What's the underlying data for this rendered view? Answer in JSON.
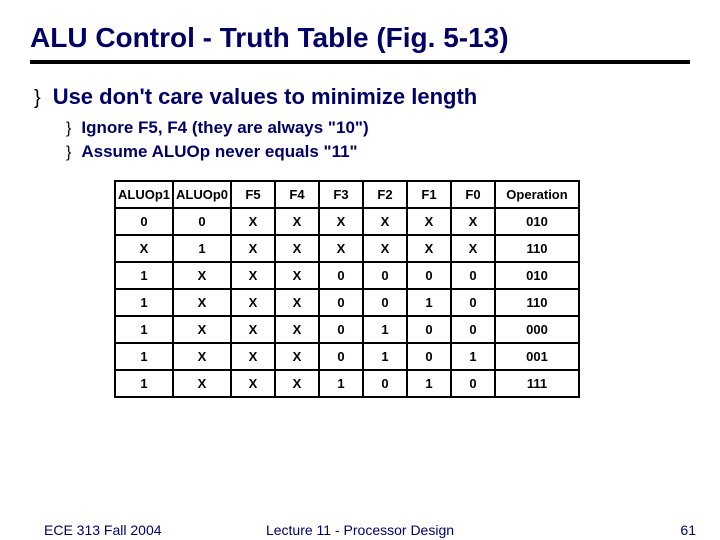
{
  "title": "ALU Control - Truth Table (Fig. 5-13)",
  "bullets": {
    "main": "Use don't care values to minimize length",
    "sub1": "Ignore F5, F4 (they are always \"10\")",
    "sub2": "Assume ALUOp never equals \"11\""
  },
  "table": {
    "headers": [
      "ALUOp1",
      "ALUOp0",
      "F5",
      "F4",
      "F3",
      "F2",
      "F1",
      "F0",
      "Operation"
    ],
    "rows": [
      [
        "0",
        "0",
        "X",
        "X",
        "X",
        "X",
        "X",
        "X",
        "010"
      ],
      [
        "X",
        "1",
        "X",
        "X",
        "X",
        "X",
        "X",
        "X",
        "110"
      ],
      [
        "1",
        "X",
        "X",
        "X",
        "0",
        "0",
        "0",
        "0",
        "010"
      ],
      [
        "1",
        "X",
        "X",
        "X",
        "0",
        "0",
        "1",
        "0",
        "110"
      ],
      [
        "1",
        "X",
        "X",
        "X",
        "0",
        "1",
        "0",
        "0",
        "000"
      ],
      [
        "1",
        "X",
        "X",
        "X",
        "0",
        "1",
        "0",
        "1",
        "001"
      ],
      [
        "1",
        "X",
        "X",
        "X",
        "1",
        "0",
        "1",
        "0",
        "111"
      ]
    ]
  },
  "footer": {
    "left": "ECE 313 Fall 2004",
    "center": "Lecture 11 - Processor Design",
    "right": "61"
  },
  "chart_data": {
    "type": "table",
    "title": "ALU Control - Truth Table (Fig. 5-13)",
    "columns": [
      "ALUOp1",
      "ALUOp0",
      "F5",
      "F4",
      "F3",
      "F2",
      "F1",
      "F0",
      "Operation"
    ],
    "rows": [
      [
        "0",
        "0",
        "X",
        "X",
        "X",
        "X",
        "X",
        "X",
        "010"
      ],
      [
        "X",
        "1",
        "X",
        "X",
        "X",
        "X",
        "X",
        "X",
        "110"
      ],
      [
        "1",
        "X",
        "X",
        "X",
        "0",
        "0",
        "0",
        "0",
        "010"
      ],
      [
        "1",
        "X",
        "X",
        "X",
        "0",
        "0",
        "1",
        "0",
        "110"
      ],
      [
        "1",
        "X",
        "X",
        "X",
        "0",
        "1",
        "0",
        "0",
        "000"
      ],
      [
        "1",
        "X",
        "X",
        "X",
        "0",
        "1",
        "0",
        "1",
        "001"
      ],
      [
        "1",
        "X",
        "X",
        "X",
        "1",
        "0",
        "1",
        "0",
        "111"
      ]
    ]
  }
}
